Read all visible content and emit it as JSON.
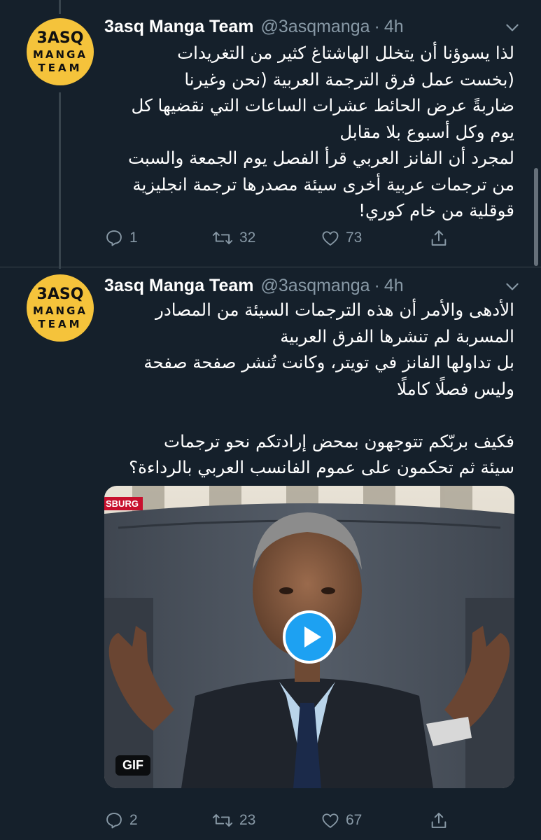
{
  "tweets": [
    {
      "display_name": "3asq Manga Team",
      "handle": "@3asqmanga",
      "separator": "·",
      "time": "4h",
      "avatar": {
        "line1": "3ASQ",
        "line2": "MANGA",
        "line3": "TEAM"
      },
      "lines": [
        "لذا يسوؤنا أن يتخلل الهاشتاغ كثير من التغريدات",
        "(بخست عمل فرق الترجمة العربية (نحن وغيرنا",
        "ضاربةً عرض الحائط عشرات الساعات التي نقضيها كل",
        "يوم وكل أسبوع بلا مقابل",
        "لمجرد أن الفانز العربي قرأ الفصل يوم الجمعة والسبت",
        "من ترجمات عربية أخرى سيئة مصدرها ترجمة انجليزية",
        "قوقلية من خام كوري!"
      ],
      "reply_count": "1",
      "retweet_count": "32",
      "like_count": "73"
    },
    {
      "display_name": "3asq Manga Team",
      "handle": "@3asqmanga",
      "separator": "·",
      "time": "4h",
      "avatar": {
        "line1": "3ASQ",
        "line2": "MANGA",
        "line3": "TEAM"
      },
      "lines_a": [
        "الأدهى والأمر أن هذه الترجمات السيئة من المصادر",
        "المسربة لم تنشرها الفرق العربية",
        "بل تداولها الفانز في تويتر، وكانت تُنشر صفحة صفحة",
        "وليس فصلًا كاملًا"
      ],
      "lines_b": [
        "فكيف بربّكم تتوجهون بمحض إرادتكم نحو ترجمات",
        "سيئة ثم تحكمون على عموم الفانسب العربي بالرداءة؟"
      ],
      "media": {
        "badge": "GIF",
        "news_tag": "SBURG"
      },
      "reply_count": "2",
      "retweet_count": "23",
      "like_count": "67"
    }
  ],
  "colors": {
    "background": "#15202b",
    "secondary_text": "#8899a6",
    "accent": "#1da1f2",
    "avatar_yellow": "#f5c33b"
  }
}
